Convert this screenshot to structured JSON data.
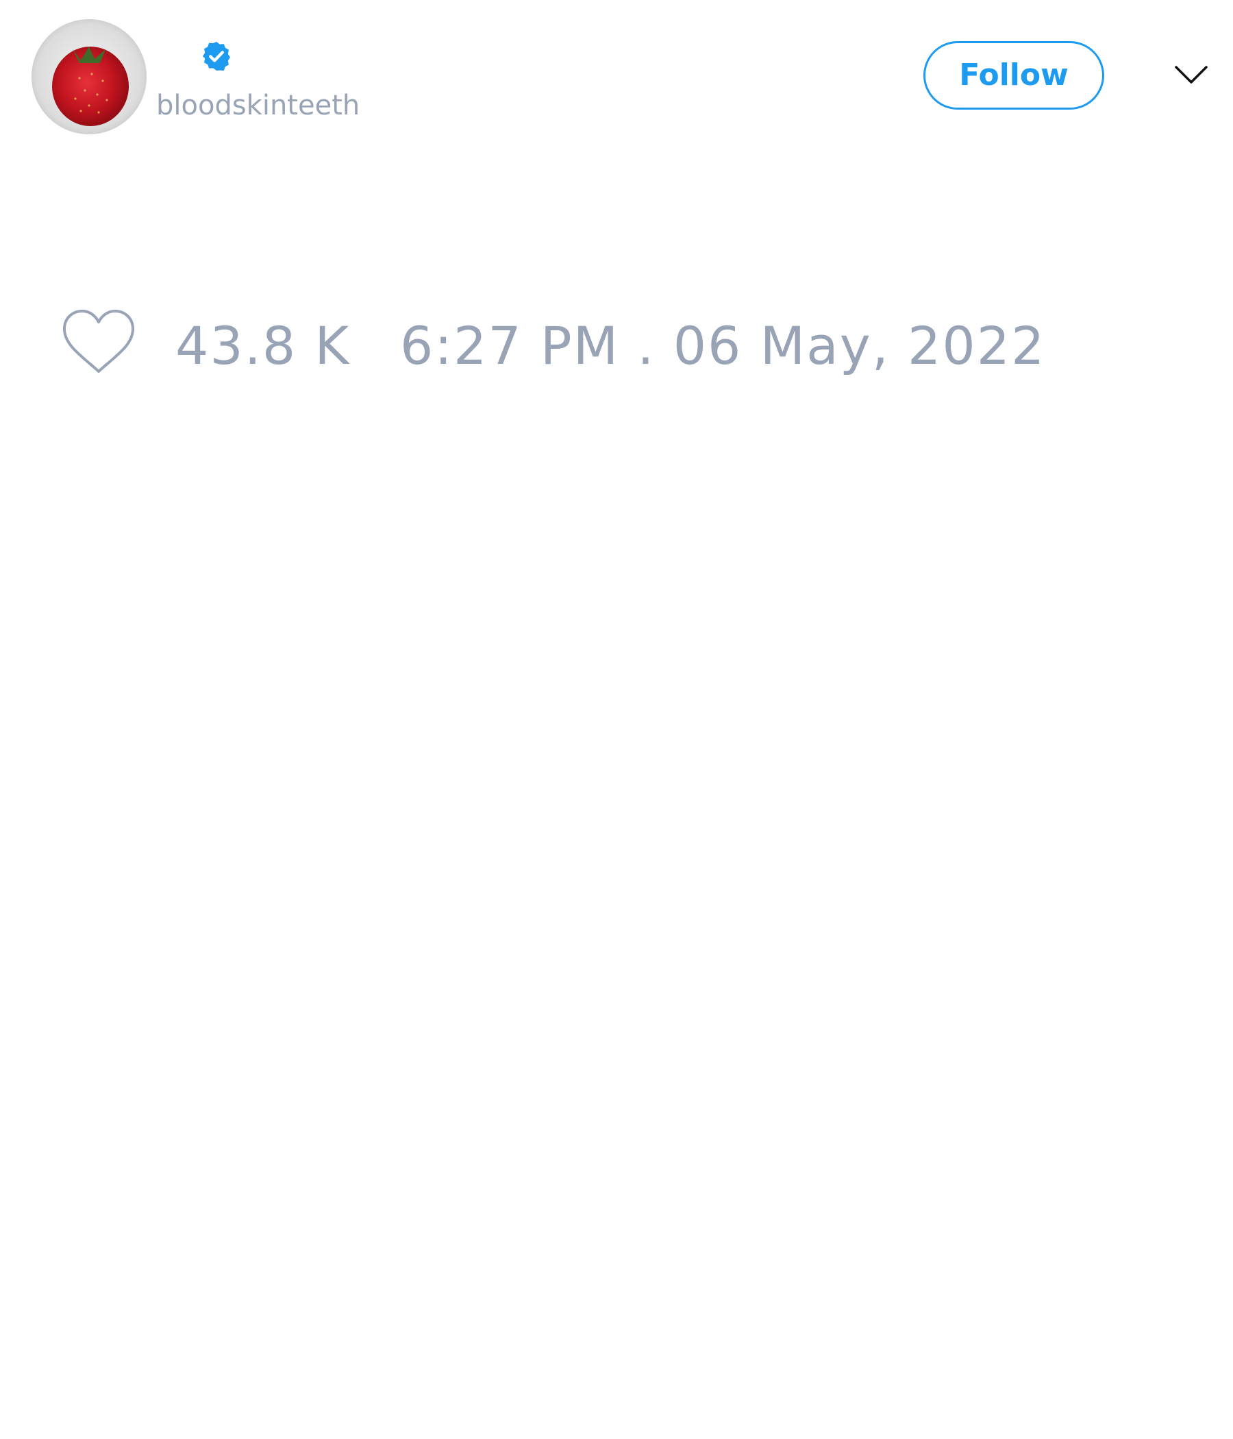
{
  "tweet": {
    "avatar_icon": "strawberry-avatar",
    "verified_icon": "verified-badge-icon",
    "handle": "bloodskinteeth",
    "follow_label": "Follow",
    "more_icon": "chevron-down-icon",
    "like_icon": "heart-icon",
    "like_count": "43.8 K",
    "timestamp": "6:27 PM . 06 May, 2022"
  },
  "colors": {
    "accent": "#1d9bf0",
    "muted_text": "#98a4b6",
    "background": "#ffffff"
  }
}
